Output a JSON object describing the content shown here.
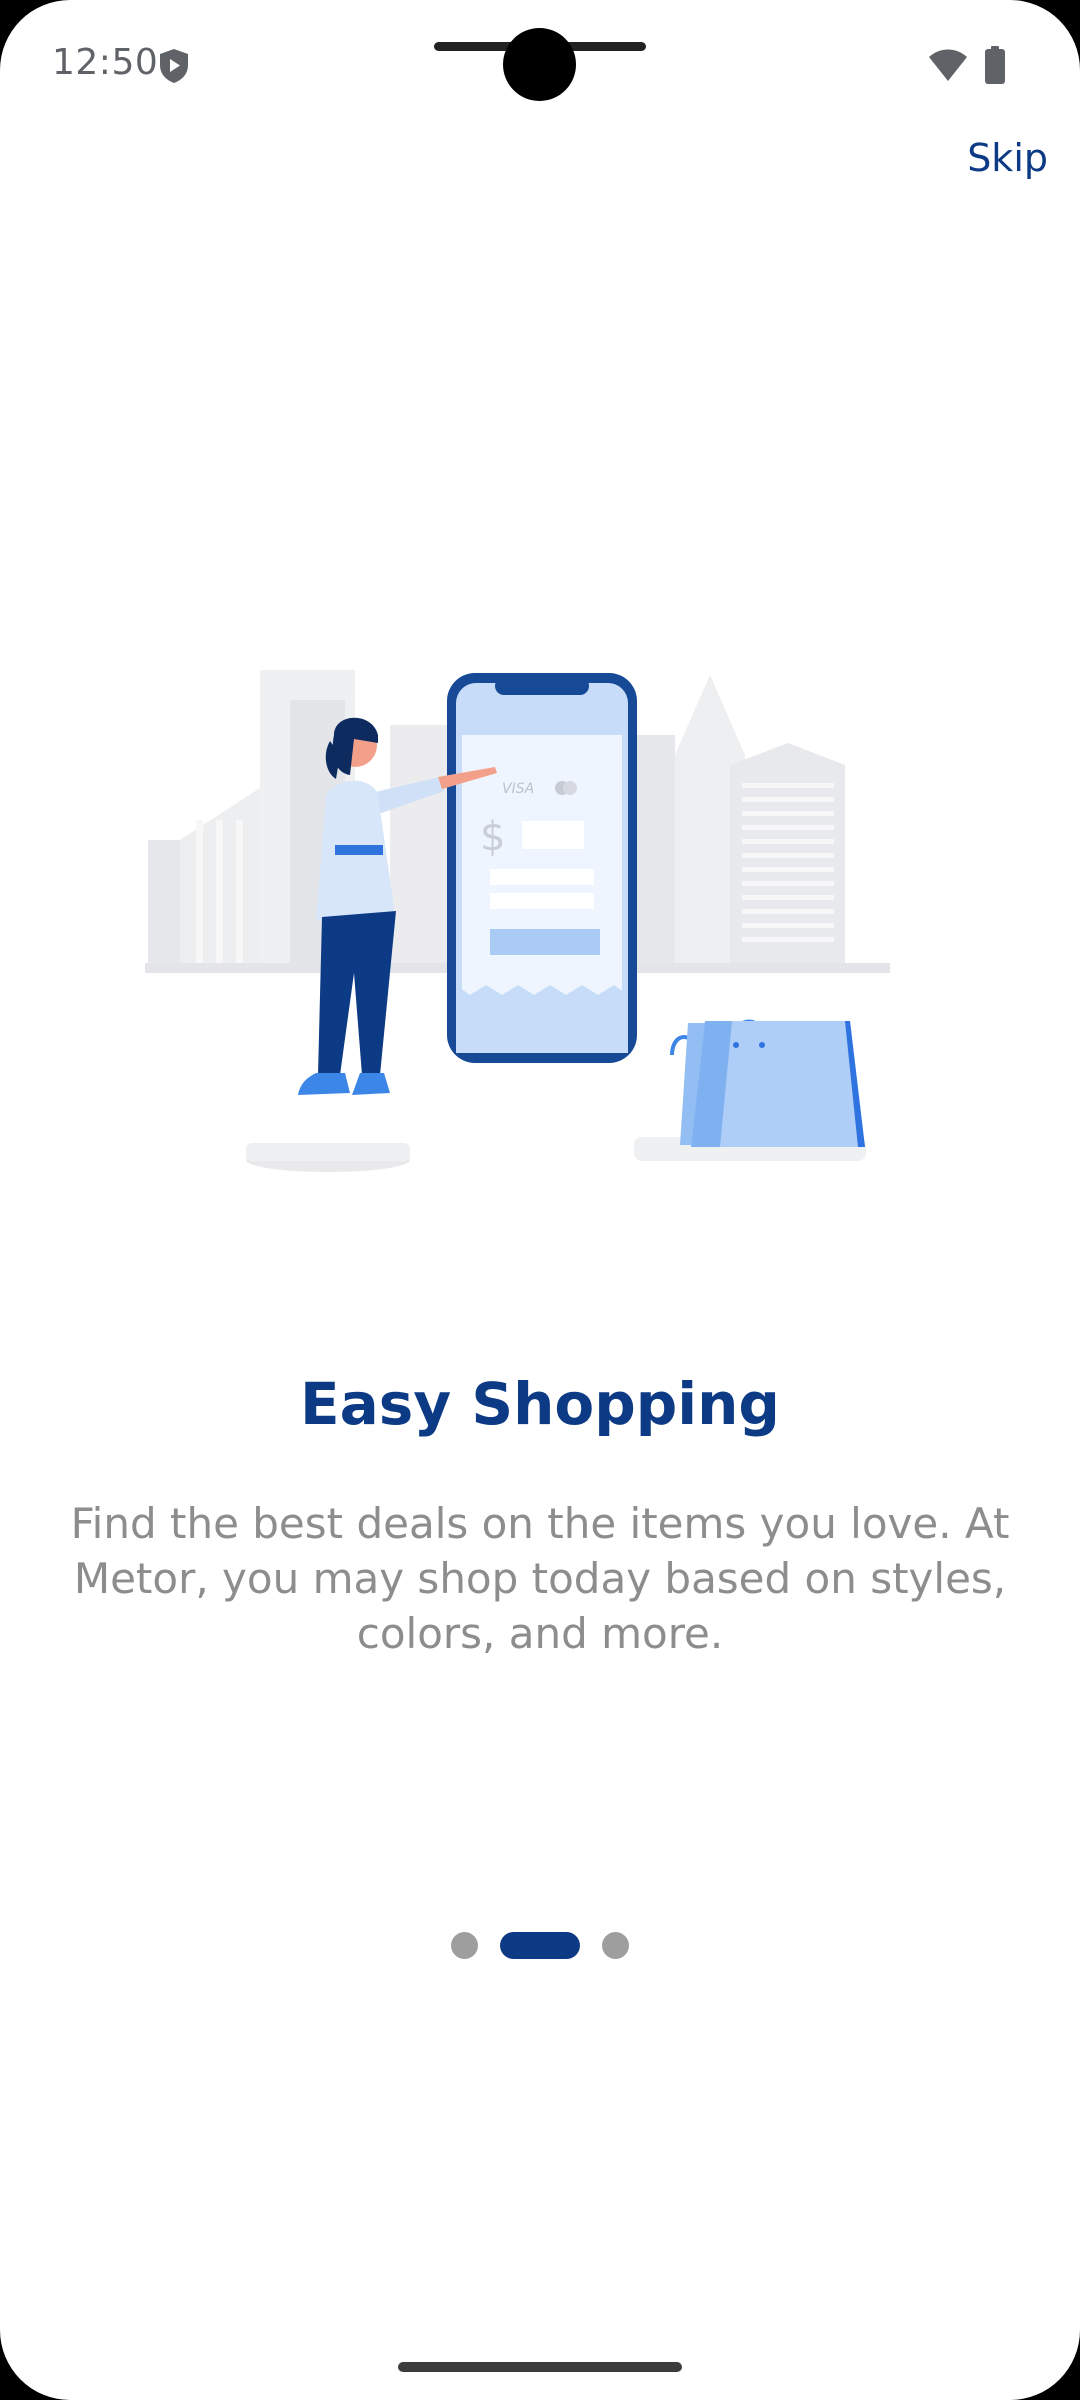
{
  "status_bar": {
    "time": "12:50",
    "icons": [
      "shield-icon",
      "wifi-icon",
      "battery-icon"
    ]
  },
  "header": {
    "skip_label": "Skip"
  },
  "onboarding": {
    "illustration": "shopping-illustration",
    "title": "Easy Shopping",
    "description": "Find the best deals on the items you love. At Metor, you may shop today based on styles, colors, and more.",
    "page_indicator": {
      "total": 3,
      "current": 2
    }
  },
  "colors": {
    "accent": "#0d3a85",
    "body_text": "#8d8d8d",
    "inactive_dot": "#9e9e9e"
  }
}
